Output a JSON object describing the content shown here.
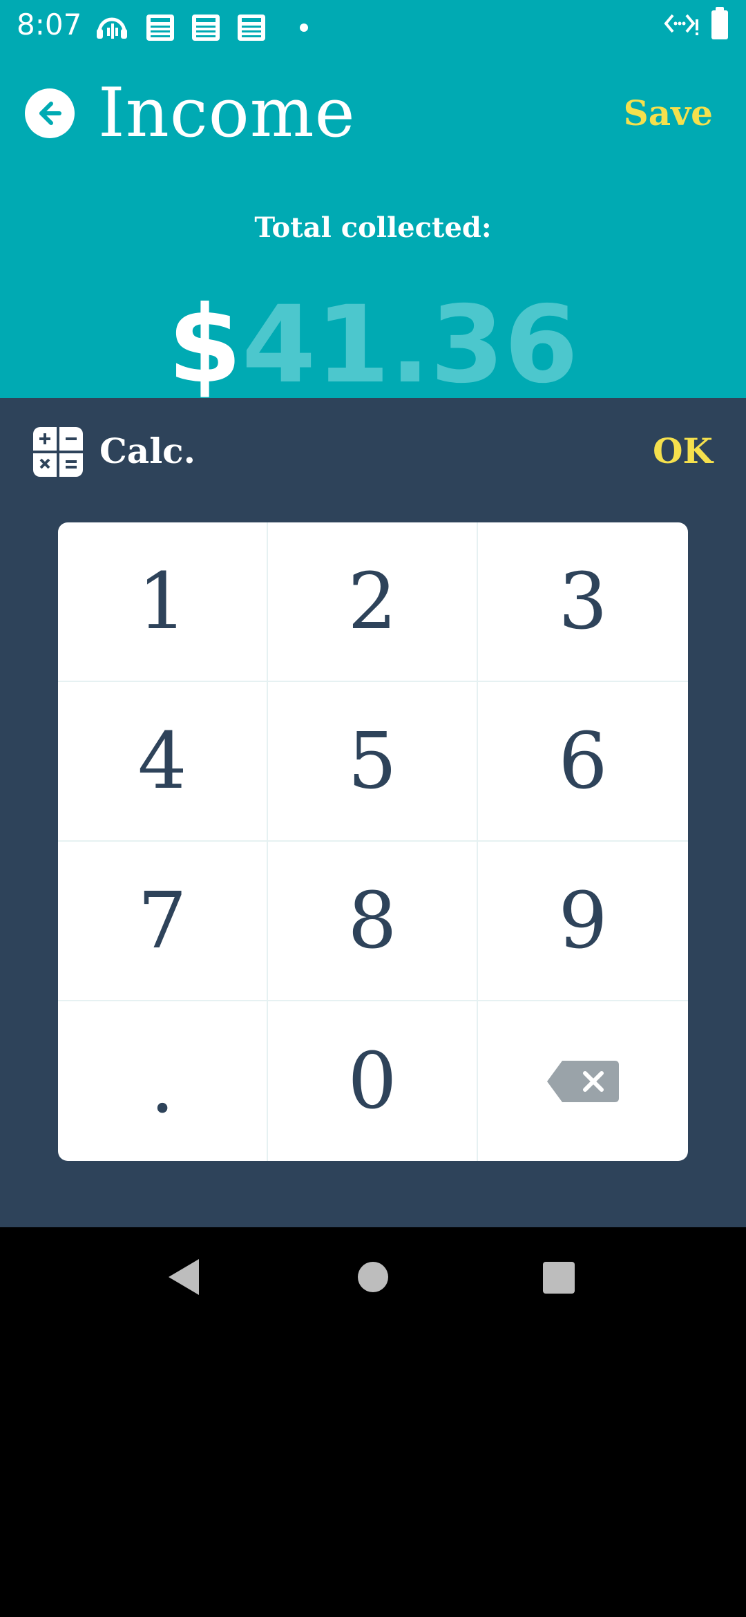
{
  "status_bar": {
    "time": "8:07",
    "left_icons": [
      "podcast-icon",
      "news-icon",
      "news-icon",
      "news-icon",
      "dot-icon"
    ],
    "right_icons": [
      "data-transfer-icon",
      "battery-icon"
    ]
  },
  "header": {
    "title": "Income",
    "save_label": "Save",
    "back_icon": "arrow-left-icon"
  },
  "summary": {
    "label": "Total collected:",
    "currency": "$",
    "amount": "41.36"
  },
  "calc": {
    "icon": "calculator-icon",
    "label": "Calc.",
    "ok_label": "OK",
    "keys": [
      "1",
      "2",
      "3",
      "4",
      "5",
      "6",
      "7",
      "8",
      "9",
      ".",
      "0"
    ],
    "backspace_icon": "backspace-icon"
  },
  "nav": {
    "back": "nav-back-icon",
    "home": "nav-home-icon",
    "recents": "nav-recents-icon"
  },
  "colors": {
    "header_bg": "#00AAB3",
    "panel_bg": "#2E435A",
    "accent": "#F5E04D",
    "amount_value": "#4CC7CD",
    "key_text": "#2E435A",
    "backspace": "#9AA3A9"
  }
}
